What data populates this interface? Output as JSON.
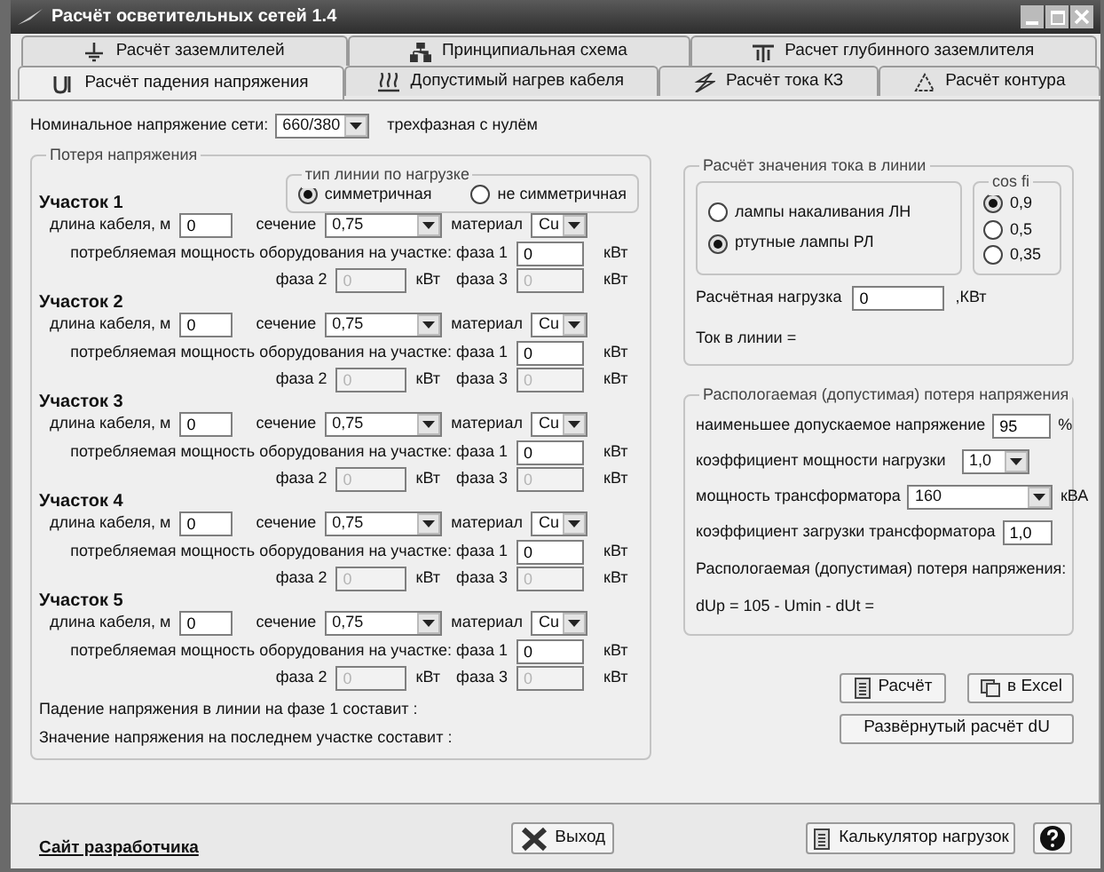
{
  "window": {
    "title": "Расчёт осветительных сетей 1.4"
  },
  "tab_rows": [
    {
      "tabs": [
        {
          "label": "Расчёт заземлителей",
          "selected": false
        },
        {
          "label": "Принципиальная схема",
          "selected": false
        },
        {
          "label": "Расчет глубинного заземлителя",
          "selected": false
        }
      ]
    },
    {
      "tabs": [
        {
          "label": "Расчёт падения напряжения",
          "selected": true
        },
        {
          "label": "Допустимый нагрев кабеля",
          "selected": false
        },
        {
          "label": "Расчёт тока КЗ",
          "selected": false
        },
        {
          "label": "Расчёт контура",
          "selected": false
        }
      ]
    }
  ],
  "voltage": {
    "label": "Номинальное напряжение сети:",
    "value": "660/380",
    "note": "трехфазная с нулём"
  },
  "voltage_loss": {
    "title": "Потеря напряжения",
    "line_type": {
      "title": "тип линии по нагрузке",
      "options": [
        {
          "label": "симметричная",
          "selected": true
        },
        {
          "label": "не симметричная",
          "selected": false
        }
      ]
    },
    "sections": [
      {
        "title": "Участок 1",
        "length_label": "длина кабеля, м",
        "length": "0",
        "cross_section_label": "сечение",
        "cross_section": "0,75",
        "material_label": "материал",
        "material": "Cu",
        "power_label": "потребляемая мощность оборудования на участке: фаза 1",
        "phase1": "0",
        "phase1_unit": "кВт",
        "phase2_label": "фаза 2",
        "phase2": "0",
        "phase2_unit": "кВт",
        "phase3_label": "фаза 3",
        "phase3": "0",
        "phase3_unit": "кВт",
        "phases_disabled": true
      },
      {
        "title": "Участок 2",
        "length_label": "длина кабеля, м",
        "length": "0",
        "cross_section_label": "сечение",
        "cross_section": "0,75",
        "material_label": "материал",
        "material": "Cu",
        "power_label": "потребляемая мощность оборудования на участке: фаза 1",
        "phase1": "0",
        "phase1_unit": "кВт",
        "phase2_label": "фаза 2",
        "phase2": "0",
        "phase2_unit": "кВт",
        "phase3_label": "фаза 3",
        "phase3": "0",
        "phase3_unit": "кВт",
        "phases_disabled": true
      },
      {
        "title": "Участок 3",
        "length_label": "длина кабеля, м",
        "length": "0",
        "cross_section_label": "сечение",
        "cross_section": "0,75",
        "material_label": "материал",
        "material": "Cu",
        "power_label": "потребляемая мощность оборудования на участке: фаза 1",
        "phase1": "0",
        "phase1_unit": "кВт",
        "phase2_label": "фаза 2",
        "phase2": "0",
        "phase2_unit": "кВт",
        "phase3_label": "фаза 3",
        "phase3": "0",
        "phase3_unit": "кВт",
        "phases_disabled": true
      },
      {
        "title": "Участок 4",
        "length_label": "длина кабеля, м",
        "length": "0",
        "cross_section_label": "сечение",
        "cross_section": "0,75",
        "material_label": "материал",
        "material": "Cu",
        "power_label": "потребляемая мощность оборудования на участке: фаза 1",
        "phase1": "0",
        "phase1_unit": "кВт",
        "phase2_label": "фаза 2",
        "phase2": "0",
        "phase2_unit": "кВт",
        "phase3_label": "фаза 3",
        "phase3": "0",
        "phase3_unit": "кВт",
        "phases_disabled": true
      },
      {
        "title": "Участок 5",
        "length_label": "длина кабеля, м",
        "length": "0",
        "cross_section_label": "сечение",
        "cross_section": "0,75",
        "material_label": "материал",
        "material": "Cu",
        "power_label": "потребляемая мощность оборудования на участке: фаза 1",
        "phase1": "0",
        "phase1_unit": "кВт",
        "phase2_label": "фаза 2",
        "phase2": "0",
        "phase2_unit": "кВт",
        "phase3_label": "фаза 3",
        "phase3": "0",
        "phase3_unit": "кВт",
        "phases_disabled": true
      }
    ],
    "results": [
      "Падение напряжения в линии на фазе 1 составит :",
      "Значение напряжения на последнем участке составит :"
    ]
  },
  "current": {
    "title": "Расчёт значения тока в линии",
    "lamps": [
      {
        "label": "лампы накаливания ЛН",
        "selected": false
      },
      {
        "label": "ртутные лампы РЛ",
        "selected": true
      }
    ],
    "cos_title": "cos fi",
    "cos_options": [
      {
        "label": "0,9",
        "selected": true
      },
      {
        "label": "0,5",
        "selected": false
      },
      {
        "label": "0,35",
        "selected": false
      }
    ],
    "load_label": "Расчётная нагрузка",
    "load": "0",
    "load_unit": ",КВт",
    "current_label": "Ток в линии ="
  },
  "allowable": {
    "title": "Распологаемая (допустимая) потеря напряжения",
    "rows": [
      {
        "kind": "input",
        "label": "наименьшее допускаемое напряжение",
        "value": "95",
        "unit": "%"
      },
      {
        "kind": "select",
        "label": "коэффициент мощности нагрузки",
        "value": "1,0"
      },
      {
        "kind": "select",
        "label": "мощность трансформатора",
        "value": "160",
        "unit": "кВА"
      },
      {
        "kind": "input",
        "label": "коэффициент загрузки трансформатора",
        "value": "1,0"
      }
    ],
    "notes": [
      "Распологаемая (допустимая) потеря напряжения:",
      "dUp = 105 - Umin - dUt ="
    ]
  },
  "actions": [
    {
      "label": "Расчёт"
    },
    {
      "label": "в Excel"
    }
  ],
  "detailed_button": "Развёрнутый расчёт dU",
  "footer": {
    "link": "Сайт разработчика",
    "exit": "Выход",
    "calculator": "Калькулятор нагрузок"
  }
}
